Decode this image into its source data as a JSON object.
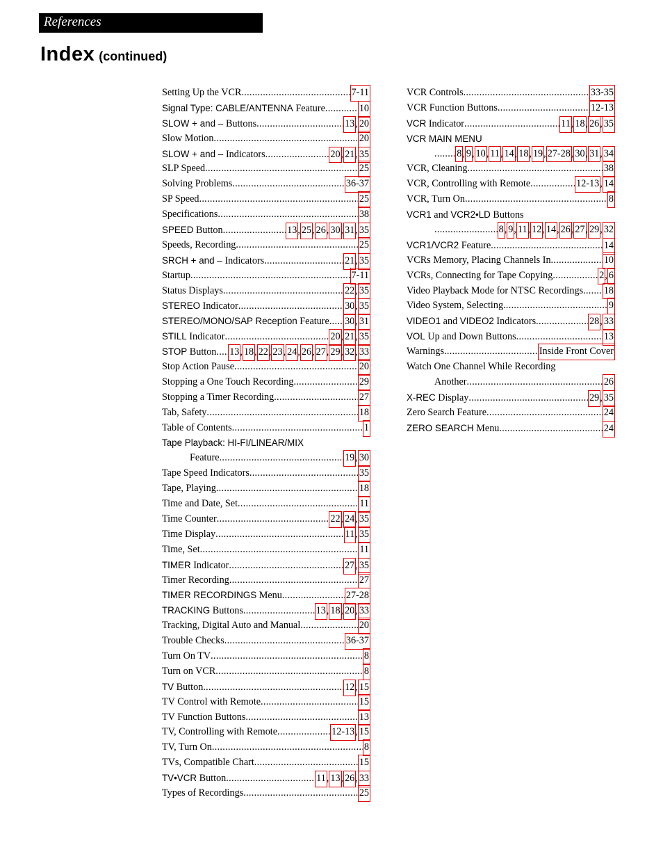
{
  "header": {
    "section": "References",
    "title": "Index",
    "subtitle": "(continued)"
  },
  "colors": {
    "link_box": "#e00000",
    "banner_bg": "#000000"
  },
  "left_column": [
    {
      "parts": [
        {
          "t": "Setting Up the VCR",
          "s": false
        }
      ],
      "pages": [
        "7-11"
      ]
    },
    {
      "parts": [
        {
          "t": "Signal Type: CABLE/ANTENNA",
          "s": true
        },
        {
          "t": " Feature",
          "s": false
        }
      ],
      "pages": [
        "10"
      ]
    },
    {
      "parts": [
        {
          "t": "SLOW + and – ",
          "s": true
        },
        {
          "t": "Buttons",
          "s": false
        }
      ],
      "pages": [
        "13",
        "20"
      ]
    },
    {
      "parts": [
        {
          "t": "Slow Motion",
          "s": false
        }
      ],
      "pages": [
        "20"
      ]
    },
    {
      "parts": [
        {
          "t": "SLOW + and – ",
          "s": true
        },
        {
          "t": "Indicators",
          "s": false
        }
      ],
      "pages": [
        "20",
        "21",
        "35"
      ]
    },
    {
      "parts": [
        {
          "t": "SLP Speed",
          "s": false
        }
      ],
      "pages": [
        "25"
      ]
    },
    {
      "parts": [
        {
          "t": "Solving Problems",
          "s": false
        }
      ],
      "pages": [
        "36-37"
      ]
    },
    {
      "parts": [
        {
          "t": "SP Speed",
          "s": false
        }
      ],
      "pages": [
        "25"
      ]
    },
    {
      "parts": [
        {
          "t": "Specifications",
          "s": false
        }
      ],
      "pages": [
        "38"
      ]
    },
    {
      "parts": [
        {
          "t": "SPEED",
          "s": true
        },
        {
          "t": " Button",
          "s": false
        }
      ],
      "pages": [
        "13",
        "25",
        "26",
        "30",
        "31",
        "35"
      ]
    },
    {
      "parts": [
        {
          "t": "Speeds, Recording",
          "s": false
        }
      ],
      "pages": [
        "25"
      ]
    },
    {
      "parts": [
        {
          "t": "SRCH + and – ",
          "s": true
        },
        {
          "t": "Indicators",
          "s": false
        }
      ],
      "pages": [
        "21",
        "35"
      ]
    },
    {
      "parts": [
        {
          "t": "Startup",
          "s": false
        }
      ],
      "pages": [
        "7-11"
      ]
    },
    {
      "parts": [
        {
          "t": "Status Displays",
          "s": false
        }
      ],
      "pages": [
        "22",
        "35"
      ]
    },
    {
      "parts": [
        {
          "t": "STEREO",
          "s": true
        },
        {
          "t": " Indicator",
          "s": false
        }
      ],
      "pages": [
        "30",
        "35"
      ]
    },
    {
      "parts": [
        {
          "t": "STEREO/MONO/SAP Reception",
          "s": true
        },
        {
          "t": " Feature",
          "s": false
        }
      ],
      "pages": [
        "30",
        "31"
      ]
    },
    {
      "parts": [
        {
          "t": "STILL",
          "s": true
        },
        {
          "t": " Indicator",
          "s": false
        }
      ],
      "pages": [
        "20",
        "21",
        "35"
      ]
    },
    {
      "parts": [
        {
          "t": "STOP",
          "s": true
        },
        {
          "t": " Button",
          "s": false
        }
      ],
      "pages": [
        "13",
        "18",
        "22",
        "23",
        "24",
        "26",
        "27",
        "29",
        "32",
        "33"
      ]
    },
    {
      "parts": [
        {
          "t": "Stop Action Pause",
          "s": false
        }
      ],
      "pages": [
        "20"
      ]
    },
    {
      "parts": [
        {
          "t": "Stopping a One Touch Recording",
          "s": false
        }
      ],
      "pages": [
        "29"
      ]
    },
    {
      "parts": [
        {
          "t": "Stopping a Timer Recording",
          "s": false
        }
      ],
      "pages": [
        "27"
      ]
    },
    {
      "parts": [
        {
          "t": "Tab, Safety",
          "s": false
        }
      ],
      "pages": [
        "18"
      ]
    },
    {
      "parts": [
        {
          "t": "Table of Contents",
          "s": false
        }
      ],
      "pages": [
        "1"
      ]
    },
    {
      "parts": [
        {
          "t": "Tape Playback: HI-FI/LINEAR/MIX",
          "s": true
        }
      ],
      "pages": [],
      "heading": true
    },
    {
      "parts": [
        {
          "t": "Feature",
          "s": false
        }
      ],
      "pages": [
        "19",
        "30"
      ],
      "indent": true
    },
    {
      "parts": [
        {
          "t": "Tape Speed Indicators",
          "s": false
        }
      ],
      "pages": [
        "35"
      ]
    },
    {
      "parts": [
        {
          "t": "Tape, Playing",
          "s": false
        }
      ],
      "pages": [
        "18"
      ]
    },
    {
      "parts": [
        {
          "t": "Time and Date, Set",
          "s": false
        }
      ],
      "pages": [
        "11"
      ]
    },
    {
      "parts": [
        {
          "t": "Time Counter",
          "s": false
        }
      ],
      "pages": [
        "22",
        "24",
        "35"
      ]
    },
    {
      "parts": [
        {
          "t": "Time Display",
          "s": false
        }
      ],
      "pages": [
        "11",
        "35"
      ]
    },
    {
      "parts": [
        {
          "t": "Time, Set",
          "s": false
        }
      ],
      "pages": [
        "11"
      ]
    },
    {
      "parts": [
        {
          "t": "TIMER",
          "s": true
        },
        {
          "t": " Indicator",
          "s": false
        }
      ],
      "pages": [
        "27",
        "35"
      ]
    },
    {
      "parts": [
        {
          "t": "Timer Recording",
          "s": false
        }
      ],
      "pages": [
        "27"
      ]
    },
    {
      "parts": [
        {
          "t": "TIMER RECORDINGS",
          "s": true
        },
        {
          "t": " Menu",
          "s": false
        }
      ],
      "pages": [
        "27-28"
      ]
    },
    {
      "parts": [
        {
          "t": "TRACKING",
          "s": true
        },
        {
          "t": " Buttons",
          "s": false
        }
      ],
      "pages": [
        "13",
        "18",
        "20",
        "33"
      ]
    },
    {
      "parts": [
        {
          "t": "Tracking, Digital Auto and Manual",
          "s": false
        }
      ],
      "pages": [
        "20"
      ]
    },
    {
      "parts": [
        {
          "t": "Trouble Checks",
          "s": false
        }
      ],
      "pages": [
        "36-37"
      ]
    },
    {
      "parts": [
        {
          "t": "Turn On TV",
          "s": false
        }
      ],
      "pages": [
        "8"
      ]
    },
    {
      "parts": [
        {
          "t": "Turn on VCR",
          "s": false
        }
      ],
      "pages": [
        "8"
      ]
    },
    {
      "parts": [
        {
          "t": "TV",
          "s": true
        },
        {
          "t": " Button",
          "s": false
        }
      ],
      "pages": [
        "12",
        "15"
      ]
    },
    {
      "parts": [
        {
          "t": "TV Control with Remote",
          "s": false
        }
      ],
      "pages": [
        "15"
      ]
    },
    {
      "parts": [
        {
          "t": "TV Function Buttons",
          "s": false
        }
      ],
      "pages": [
        "13"
      ]
    },
    {
      "parts": [
        {
          "t": "TV, Controlling with Remote",
          "s": false
        }
      ],
      "pages": [
        "12-13",
        "15"
      ]
    },
    {
      "parts": [
        {
          "t": "TV, Turn On",
          "s": false
        }
      ],
      "pages": [
        "8"
      ]
    },
    {
      "parts": [
        {
          "t": "TVs, Compatible Chart",
          "s": false
        }
      ],
      "pages": [
        "15"
      ]
    },
    {
      "parts": [
        {
          "t": "TV•VCR",
          "s": true
        },
        {
          "t": " Button",
          "s": false
        }
      ],
      "pages": [
        "11",
        "13",
        "26",
        "33"
      ]
    },
    {
      "parts": [
        {
          "t": "Types of Recordings",
          "s": false
        }
      ],
      "pages": [
        "25"
      ]
    }
  ],
  "right_column": [
    {
      "parts": [
        {
          "t": "VCR Controls",
          "s": false
        }
      ],
      "pages": [
        "33-35"
      ]
    },
    {
      "parts": [
        {
          "t": "VCR Function Buttons",
          "s": false
        }
      ],
      "pages": [
        "12-13"
      ]
    },
    {
      "parts": [
        {
          "t": "VCR",
          "s": true
        },
        {
          "t": " Indicator",
          "s": false
        }
      ],
      "pages": [
        "11",
        "18",
        "26",
        "35"
      ]
    },
    {
      "parts": [
        {
          "t": "VCR MAIN MENU",
          "s": true
        }
      ],
      "pages": [],
      "heading": true
    },
    {
      "parts": [
        {
          "t": "",
          "s": false
        }
      ],
      "pages": [
        "8",
        "9",
        "10",
        "11",
        "14",
        "18",
        "19",
        "27-28",
        "30",
        "31",
        "34"
      ],
      "indent": true
    },
    {
      "parts": [
        {
          "t": "VCR, Cleaning",
          "s": false
        }
      ],
      "pages": [
        "38"
      ]
    },
    {
      "parts": [
        {
          "t": "VCR, Controlling with Remote",
          "s": false
        }
      ],
      "pages": [
        "12-13",
        "14"
      ]
    },
    {
      "parts": [
        {
          "t": "VCR, Turn On",
          "s": false
        }
      ],
      "pages": [
        "8"
      ]
    },
    {
      "parts": [
        {
          "t": "VCR1",
          "s": true
        },
        {
          "t": " and ",
          "s": false
        },
        {
          "t": "VCR2•LD",
          "s": true
        },
        {
          "t": " Buttons",
          "s": false
        }
      ],
      "pages": [],
      "heading": true
    },
    {
      "parts": [
        {
          "t": "",
          "s": false
        }
      ],
      "pages": [
        "8",
        "9",
        "11",
        "12",
        "14",
        "26",
        "27",
        "29",
        "32"
      ],
      "indent": true
    },
    {
      "parts": [
        {
          "t": "VCR1/VCR2",
          "s": true
        },
        {
          "t": " Feature",
          "s": false
        }
      ],
      "pages": [
        "14"
      ]
    },
    {
      "parts": [
        {
          "t": "VCRs Memory, Placing Channels In",
          "s": false
        }
      ],
      "pages": [
        "10"
      ]
    },
    {
      "parts": [
        {
          "t": "VCRs, Connecting for Tape Copying",
          "s": false
        }
      ],
      "pages": [
        "2",
        "6"
      ]
    },
    {
      "parts": [
        {
          "t": "Video Playback Mode for NTSC Recordings",
          "s": false
        }
      ],
      "pages": [
        "18"
      ]
    },
    {
      "parts": [
        {
          "t": "Video System, Selecting",
          "s": false
        }
      ],
      "pages": [
        "9"
      ]
    },
    {
      "parts": [
        {
          "t": "VIDEO1",
          "s": true
        },
        {
          "t": " and ",
          "s": false
        },
        {
          "t": "VIDEO2",
          "s": true
        },
        {
          "t": " Indicators",
          "s": false
        }
      ],
      "pages": [
        "28",
        "33"
      ]
    },
    {
      "parts": [
        {
          "t": "VOL",
          "s": true
        },
        {
          "t": " Up and Down Buttons",
          "s": false
        }
      ],
      "pages": [
        "13"
      ]
    },
    {
      "parts": [
        {
          "t": "Warnings",
          "s": false
        }
      ],
      "pages": [
        "Inside Front Cover"
      ]
    },
    {
      "parts": [
        {
          "t": "Watch One Channel While Recording",
          "s": false
        }
      ],
      "pages": [],
      "heading": true
    },
    {
      "parts": [
        {
          "t": "Another",
          "s": false
        }
      ],
      "pages": [
        "26"
      ],
      "indent": true
    },
    {
      "parts": [
        {
          "t": "X-REC",
          "s": true
        },
        {
          "t": " Display",
          "s": false
        }
      ],
      "pages": [
        "29",
        "35"
      ]
    },
    {
      "parts": [
        {
          "t": "Zero Search Feature",
          "s": false
        }
      ],
      "pages": [
        "24"
      ]
    },
    {
      "parts": [
        {
          "t": "ZERO SEARCH",
          "s": true
        },
        {
          "t": " Menu",
          "s": false
        }
      ],
      "pages": [
        "24"
      ]
    }
  ]
}
